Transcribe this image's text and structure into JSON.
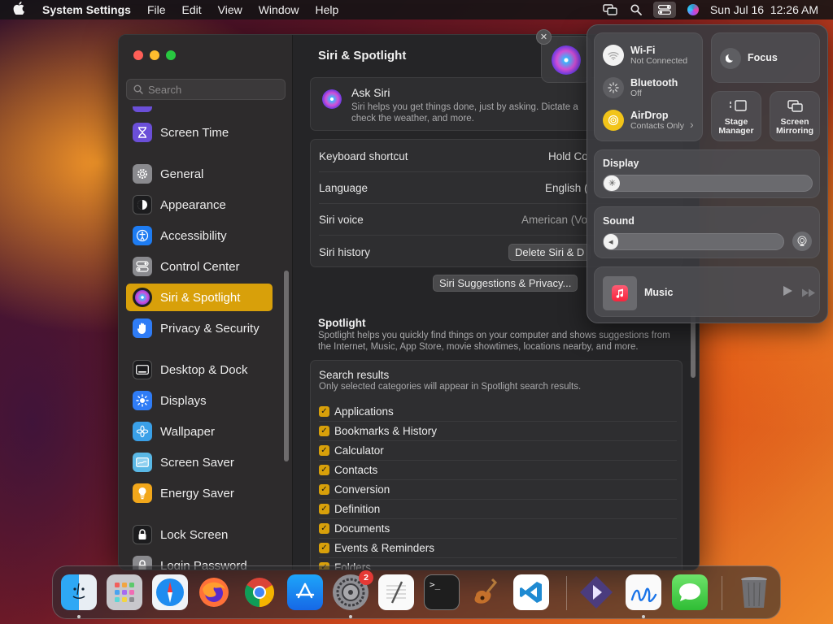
{
  "menubar": {
    "app_name": "System Settings",
    "items": [
      "File",
      "Edit",
      "View",
      "Window",
      "Help"
    ],
    "clock": "Sun Jul 16  12:26 AM"
  },
  "sidebar": {
    "search_placeholder": "Search",
    "items": [
      {
        "label": "Screen Time",
        "icon": "hourglass-icon",
        "color": "#6b4fd8"
      },
      {
        "label": "General",
        "icon": "gear-icon",
        "color": "#8a8a8e"
      },
      {
        "label": "Appearance",
        "icon": "appearance-icon",
        "color": "#1c1c1e"
      },
      {
        "label": "Accessibility",
        "icon": "accessibility-icon",
        "color": "#1e7cf2"
      },
      {
        "label": "Control Center",
        "icon": "switches-icon",
        "color": "#8a8a8e"
      },
      {
        "label": "Siri & Spotlight",
        "icon": "siri-icon",
        "color": "#2a2a2e",
        "active": true
      },
      {
        "label": "Privacy & Security",
        "icon": "hand-icon",
        "color": "#2f7cf6"
      },
      {
        "label": "Desktop & Dock",
        "icon": "dock-icon",
        "color": "#1c1c1e"
      },
      {
        "label": "Displays",
        "icon": "sun-icon",
        "color": "#2f7cf6"
      },
      {
        "label": "Wallpaper",
        "icon": "flower-icon",
        "color": "#3aa0e8"
      },
      {
        "label": "Screen Saver",
        "icon": "screensaver-icon",
        "color": "#5ab8e6"
      },
      {
        "label": "Energy Saver",
        "icon": "bulb-icon",
        "color": "#f2a71b"
      },
      {
        "label": "Lock Screen",
        "icon": "lock-icon",
        "color": "#1c1c1e"
      },
      {
        "label": "Login Password",
        "icon": "lock-icon",
        "color": "#8a8a8e"
      }
    ]
  },
  "content": {
    "title": "Siri & Spotlight",
    "ask_siri": {
      "title": "Ask Siri",
      "description": "Siri helps you get things done, just by asking. Dictate a check the weather, and more."
    },
    "settings_rows": [
      {
        "label": "Keyboard shortcut",
        "value": "Hold Co"
      },
      {
        "label": "Language",
        "value": "English ("
      },
      {
        "label": "Siri voice",
        "value": "American (Vo"
      },
      {
        "label": "Siri history",
        "button": "Delete Siri & D"
      }
    ],
    "suggestions_button": "Siri Suggestions & Privacy...",
    "spotlight": {
      "title": "Spotlight",
      "description": "Spotlight helps you quickly find things on your computer and shows suggestions from the Internet, Music, App Store, movie showtimes, locations nearby, and more."
    },
    "search_results": {
      "title": "Search results",
      "description": "Only selected categories will appear in Spotlight search results.",
      "items": [
        "Applications",
        "Bookmarks & History",
        "Calculator",
        "Contacts",
        "Conversion",
        "Definition",
        "Documents",
        "Events & Reminders",
        "Folders"
      ]
    }
  },
  "control_center": {
    "wifi": {
      "title": "Wi-Fi",
      "status": "Not Connected"
    },
    "bluetooth": {
      "title": "Bluetooth",
      "status": "Off"
    },
    "airdrop": {
      "title": "AirDrop",
      "status": "Contacts Only"
    },
    "focus": "Focus",
    "stage_manager": [
      "Stage",
      "Manager"
    ],
    "screen_mirroring": [
      "Screen",
      "Mirroring"
    ],
    "display_label": "Display",
    "display_level": 0.03,
    "sound_label": "Sound",
    "sound_level": 0.03,
    "music_label": "Music"
  },
  "dock": {
    "settings_badge": "2",
    "apps": [
      "finder-icon",
      "launchpad-icon",
      "safari-icon",
      "firefox-icon",
      "chrome-icon",
      "app-store-icon",
      "system-settings-icon",
      "textedit-icon",
      "terminal-icon",
      "garageband-icon",
      "vscode-icon",
      "shortcuts-icon",
      "freeform-icon",
      "messages-icon",
      "trash-icon"
    ]
  },
  "colors": {
    "accent": "#d8a00a",
    "sidebar_bg": "#2d2b2c",
    "window_bg": "#252527"
  }
}
